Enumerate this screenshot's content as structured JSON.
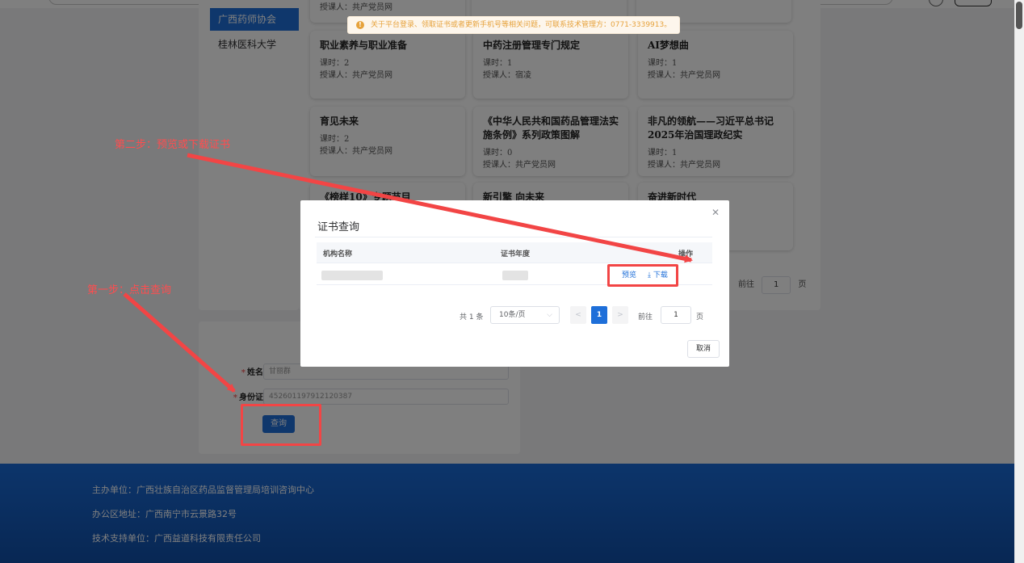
{
  "sidebar": {
    "items": [
      {
        "label": "广西药师协会",
        "active": true
      },
      {
        "label": "桂林医科大学",
        "active": false
      }
    ]
  },
  "courses": [
    {
      "title": "",
      "hours": "",
      "teacher": "授课人：共产党员网"
    },
    {
      "title": "职业素养与职业准备",
      "hours": "课时：2",
      "teacher": "授课人：共产党员网"
    },
    {
      "title": "中药注册管理专门规定",
      "hours": "课时：1",
      "teacher": "授课人：宿凌"
    },
    {
      "title": "AI梦想曲",
      "hours": "课时：1",
      "teacher": "授课人：共产党员网"
    },
    {
      "title": "育见未来",
      "hours": "课时：2",
      "teacher": "授课人：共产党员网"
    },
    {
      "title": "《中华人民共和国药品管理法实施条例》系列政策图解",
      "hours": "课时：0",
      "teacher": "授课人：共产党员网"
    },
    {
      "title": "非凡的领航——习近平总书记2025年治国理政纪实",
      "hours": "课时：1",
      "teacher": "授课人：共产党员网"
    },
    {
      "title": "《榜样10》专题节目",
      "hours": "",
      "teacher": ""
    },
    {
      "title": "新引擎 向未来",
      "hours": "",
      "teacher": ""
    },
    {
      "title": "奋进新时代",
      "hours": "",
      "teacher": ""
    }
  ],
  "course_pager": {
    "goto_label": "前往",
    "page": "1",
    "page_suffix": "页"
  },
  "form": {
    "name_label": "姓名",
    "name_value": "甘丽群",
    "id_label": "身份证",
    "id_value": "452601197912120387",
    "query_button": "查询"
  },
  "footer": {
    "host": "主办单位：广西壮族自治区药品监督管理局培训咨询中心",
    "address": "办公区地址：广西南宁市云景路32号",
    "support": "技术支持单位：广西益道科技有限责任公司"
  },
  "notice": {
    "text": "关于平台登录、领取证书或者更新手机号等相关问题，可联系技术管理方：0771-3339913。",
    "icon": "warning-icon"
  },
  "dialog": {
    "title": "证书查询",
    "columns": [
      "机构名称",
      "证书年度",
      "操作"
    ],
    "row": {
      "preview": "预览",
      "download": "下载"
    },
    "pagination": {
      "total": "共 1 条",
      "page_size": "10条/页",
      "prev": "<",
      "current": "1",
      "next": ">",
      "goto": "前往",
      "goto_value": "1",
      "page_suffix": "页"
    },
    "cancel": "取消"
  },
  "annotations": {
    "step1": "第一步：点击查询",
    "step2": "第二步：预览或下载证书"
  },
  "colors": {
    "accent": "#1e6fd9",
    "annotation": "#f24545",
    "warning": "#e6a23c"
  }
}
